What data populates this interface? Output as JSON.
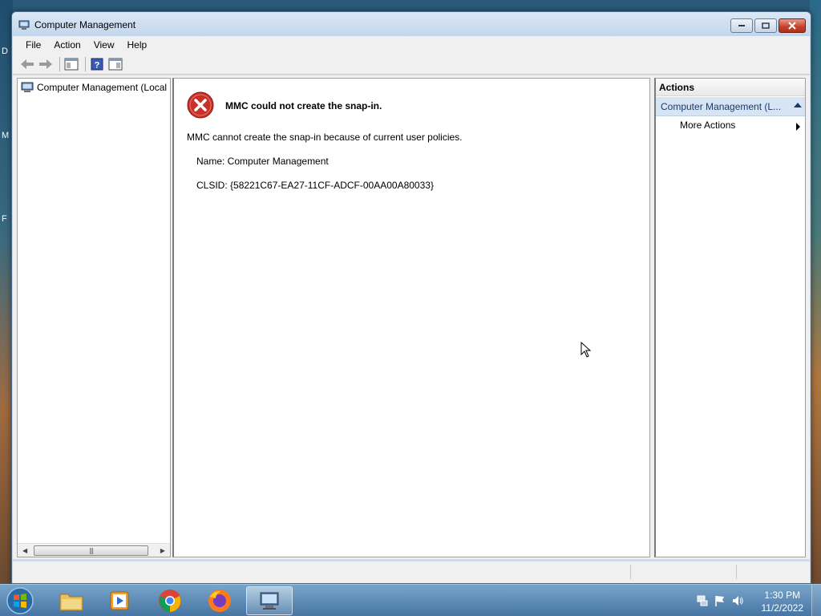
{
  "desktop": {
    "edge_marks": [
      "D",
      "M",
      "F"
    ]
  },
  "window": {
    "title": "Computer Management",
    "controls": {
      "minimize": "minimize",
      "maximize": "maximize",
      "close": "close"
    }
  },
  "menu": {
    "items": [
      {
        "label": "File"
      },
      {
        "label": "Action"
      },
      {
        "label": "View"
      },
      {
        "label": "Help"
      }
    ]
  },
  "tree": {
    "root_label": "Computer Management (Local"
  },
  "error": {
    "title": "MMC could not create the snap-in.",
    "message": "MMC cannot create the snap-in because of current user policies.",
    "name_line": "Name: Computer Management",
    "clsid_line": "CLSID: {58221C67-EA27-11CF-ADCF-00AA00A80033}"
  },
  "actions": {
    "header": "Actions",
    "section": "Computer Management (L...",
    "more_actions": "More Actions"
  },
  "taskbar": {
    "apps": [
      {
        "name": "file-explorer",
        "active": false
      },
      {
        "name": "media-player",
        "active": false
      },
      {
        "name": "chrome",
        "active": false
      },
      {
        "name": "firefox",
        "active": false
      },
      {
        "name": "computer-management",
        "active": true
      }
    ],
    "clock_time": "1:30 PM",
    "clock_date": "11/2/2022"
  },
  "colors": {
    "error_red": "#c8302a",
    "action_section_bg": "#d6e4f3",
    "titlebar": "#c2d6ec"
  }
}
